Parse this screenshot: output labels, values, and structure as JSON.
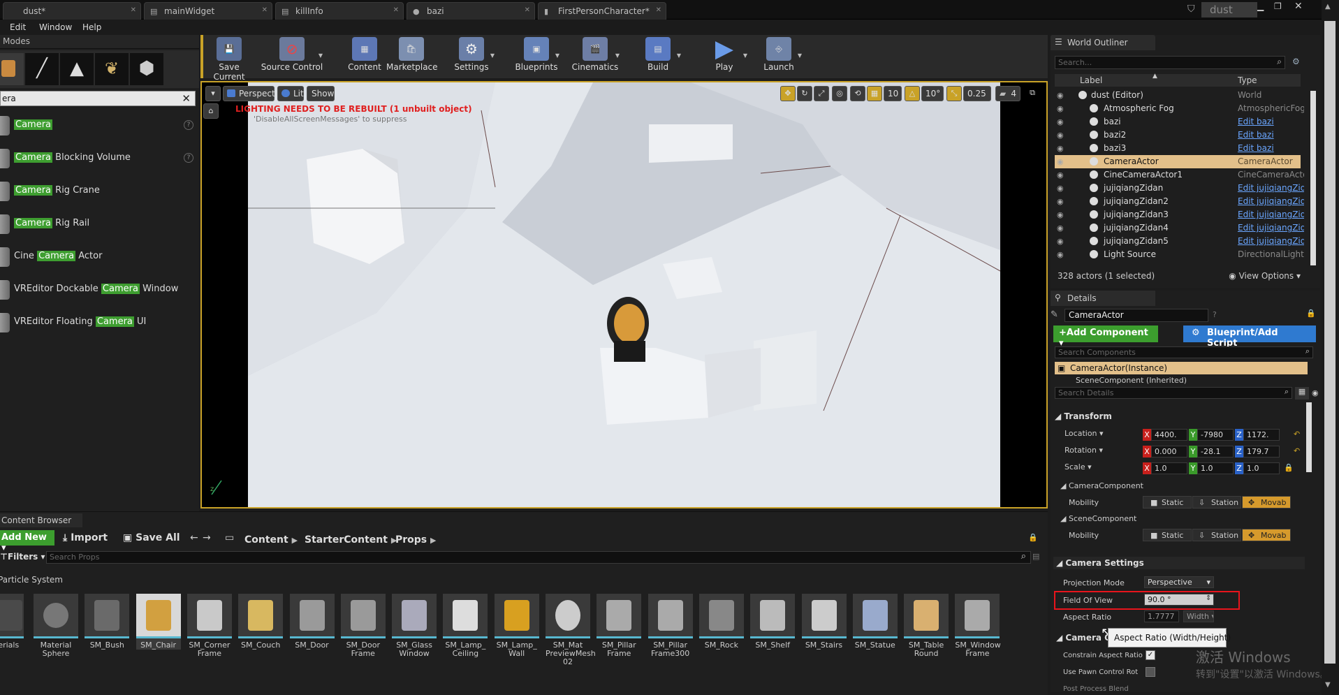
{
  "tabs": [
    {
      "label": "dust*",
      "icon": "level-icon"
    },
    {
      "label": "mainWidget",
      "icon": "widget-icon"
    },
    {
      "label": "killInfo",
      "icon": "widget-icon"
    },
    {
      "label": "bazi",
      "icon": "material-icon"
    },
    {
      "label": "FirstPersonCharacter*",
      "icon": "blueprint-icon"
    }
  ],
  "project_name": "dust",
  "menu": [
    "Edit",
    "Window",
    "Help"
  ],
  "modes": {
    "title": "Modes",
    "search_value": "era",
    "results": [
      {
        "pre": "",
        "match": "Camera",
        "post": "",
        "help": true
      },
      {
        "pre": "",
        "match": "Camera",
        "post": " Blocking Volume",
        "help": true
      },
      {
        "pre": "",
        "match": "Camera",
        "post": " Rig Crane",
        "help": false
      },
      {
        "pre": "",
        "match": "Camera",
        "post": " Rig Rail",
        "help": false
      },
      {
        "pre": "Cine ",
        "match": "Camera",
        "post": " Actor",
        "help": false
      },
      {
        "pre": "VREditor Dockable ",
        "match": "Camera",
        "post": " Window",
        "help": false
      },
      {
        "pre": "VREditor Floating ",
        "match": "Camera",
        "post": " UI",
        "help": false
      }
    ]
  },
  "toolbar": [
    {
      "label": "Save Current",
      "icon": "save-icon",
      "dropdown": false
    },
    {
      "label": "Source Control",
      "icon": "source-control-icon",
      "dropdown": true
    },
    {
      "label": "Content",
      "icon": "content-icon",
      "dropdown": false
    },
    {
      "label": "Marketplace",
      "icon": "marketplace-icon",
      "dropdown": false
    },
    {
      "label": "Settings",
      "icon": "settings-icon",
      "dropdown": true
    },
    {
      "label": "Blueprints",
      "icon": "blueprints-icon",
      "dropdown": true
    },
    {
      "label": "Cinematics",
      "icon": "cinematics-icon",
      "dropdown": true
    },
    {
      "label": "Build",
      "icon": "build-icon",
      "dropdown": true
    },
    {
      "label": "Play",
      "icon": "play-icon",
      "dropdown": true
    },
    {
      "label": "Launch",
      "icon": "launch-icon",
      "dropdown": true
    }
  ],
  "viewport": {
    "perspective_label": "Perspective",
    "lit_label": "Lit",
    "show_label": "Show",
    "grid_snap": "10",
    "rotation_snap": "10°",
    "scale_snap": "0.25",
    "camera_speed": "4",
    "warning": "LIGHTING NEEDS TO BE REBUILT (1 unbuilt object)",
    "warning_hint": "'DisableAllScreenMessages' to suppress"
  },
  "outliner": {
    "title": "World Outliner",
    "search_placeholder": "Search...",
    "col_label": "Label",
    "col_type": "Type",
    "rows": [
      {
        "label": "dust (Editor)",
        "type": "World",
        "link": false,
        "selected": false
      },
      {
        "label": "Atmospheric Fog",
        "type": "AtmosphericFog",
        "link": false,
        "selected": false
      },
      {
        "label": "bazi",
        "type": "Edit bazi",
        "link": true,
        "selected": false
      },
      {
        "label": "bazi2",
        "type": "Edit bazi",
        "link": true,
        "selected": false
      },
      {
        "label": "bazi3",
        "type": "Edit bazi",
        "link": true,
        "selected": false
      },
      {
        "label": "CameraActor",
        "type": "CameraActor",
        "link": false,
        "selected": true
      },
      {
        "label": "CineCameraActor1",
        "type": "CineCameraActor",
        "link": false,
        "selected": false
      },
      {
        "label": "jujiqiangZidan",
        "type": "Edit jujiqiangZida",
        "link": true,
        "selected": false
      },
      {
        "label": "jujiqiangZidan2",
        "type": "Edit jujiqiangZida",
        "link": true,
        "selected": false
      },
      {
        "label": "jujiqiangZidan3",
        "type": "Edit jujiqiangZida",
        "link": true,
        "selected": false
      },
      {
        "label": "jujiqiangZidan4",
        "type": "Edit jujiqiangZida",
        "link": true,
        "selected": false
      },
      {
        "label": "jujiqiangZidan5",
        "type": "Edit jujiqiangZida",
        "link": true,
        "selected": false
      },
      {
        "label": "Light Source",
        "type": "DirectionalLight",
        "link": false,
        "selected": false
      }
    ],
    "status": "328 actors (1 selected)",
    "view_options": "View Options"
  },
  "details": {
    "title": "Details",
    "name_value": "CameraActor",
    "add_component": "+Add Component",
    "blueprint_script": "Blueprint/Add Script",
    "search_components_placeholder": "Search Components",
    "instance": "CameraActor(Instance)",
    "scene_component": "SceneComponent (Inherited)",
    "search_details_placeholder": "Search Details",
    "transform_header": "Transform",
    "location_label": "Location",
    "rotation_label": "Rotation",
    "scale_label": "Scale",
    "location": [
      "4400.",
      "-7980",
      "1172."
    ],
    "rotation": [
      "0.000",
      "-28.1",
      "179.7"
    ],
    "scale": [
      "1.0",
      "1.0",
      "1.0"
    ],
    "camera_component": "CameraComponent",
    "scene_component_sub": "SceneComponent",
    "mobility_label": "Mobility",
    "mobility_options": [
      "Static",
      "Station",
      "Movab"
    ],
    "camera_settings_header": "Camera Settings",
    "projection_mode_label": "Projection Mode",
    "projection_mode_value": "Perspective",
    "fov_label": "Field Of View",
    "fov_value": "90.0 °",
    "aspect_ratio_label": "Aspect Ratio",
    "aspect_ratio_value": "1.7777",
    "aspect_preset": "Width",
    "camera_options_header": "Camera Op",
    "constrain_label": "Constrain Aspect Ratio",
    "pawn_label": "Use Pawn Control Rot",
    "post_label": "Post Process Blend",
    "tooltip": "Aspect Ratio (Width/Height)",
    "watermark1": "激活 Windows",
    "watermark2": "转到\"设置\"以激活 Windows。"
  },
  "content_browser": {
    "title": "Content Browser",
    "add_new": "Add New",
    "import": "Import",
    "save_all": "Save All",
    "breadcrumb": [
      "Content",
      "StarterContent",
      "Props"
    ],
    "filters": "Filters",
    "search_placeholder": "Search Props",
    "folder": "Particle System",
    "assets": [
      "Materials",
      "Material Sphere",
      "SM_Bush",
      "SM_Chair",
      "SM_Corner Frame",
      "SM_Couch",
      "SM_Door",
      "SM_Door Frame",
      "SM_Glass Window",
      "SM_Lamp_ Ceiling",
      "SM_Lamp_ Wall",
      "SM_Mat PreviewMesh 02",
      "SM_Pillar Frame",
      "SM_Pillar Frame300",
      "SM_Rock",
      "SM_Shelf",
      "SM_Stairs",
      "SM_Statue",
      "SM_Table Round",
      "SM_Window Frame"
    ]
  }
}
